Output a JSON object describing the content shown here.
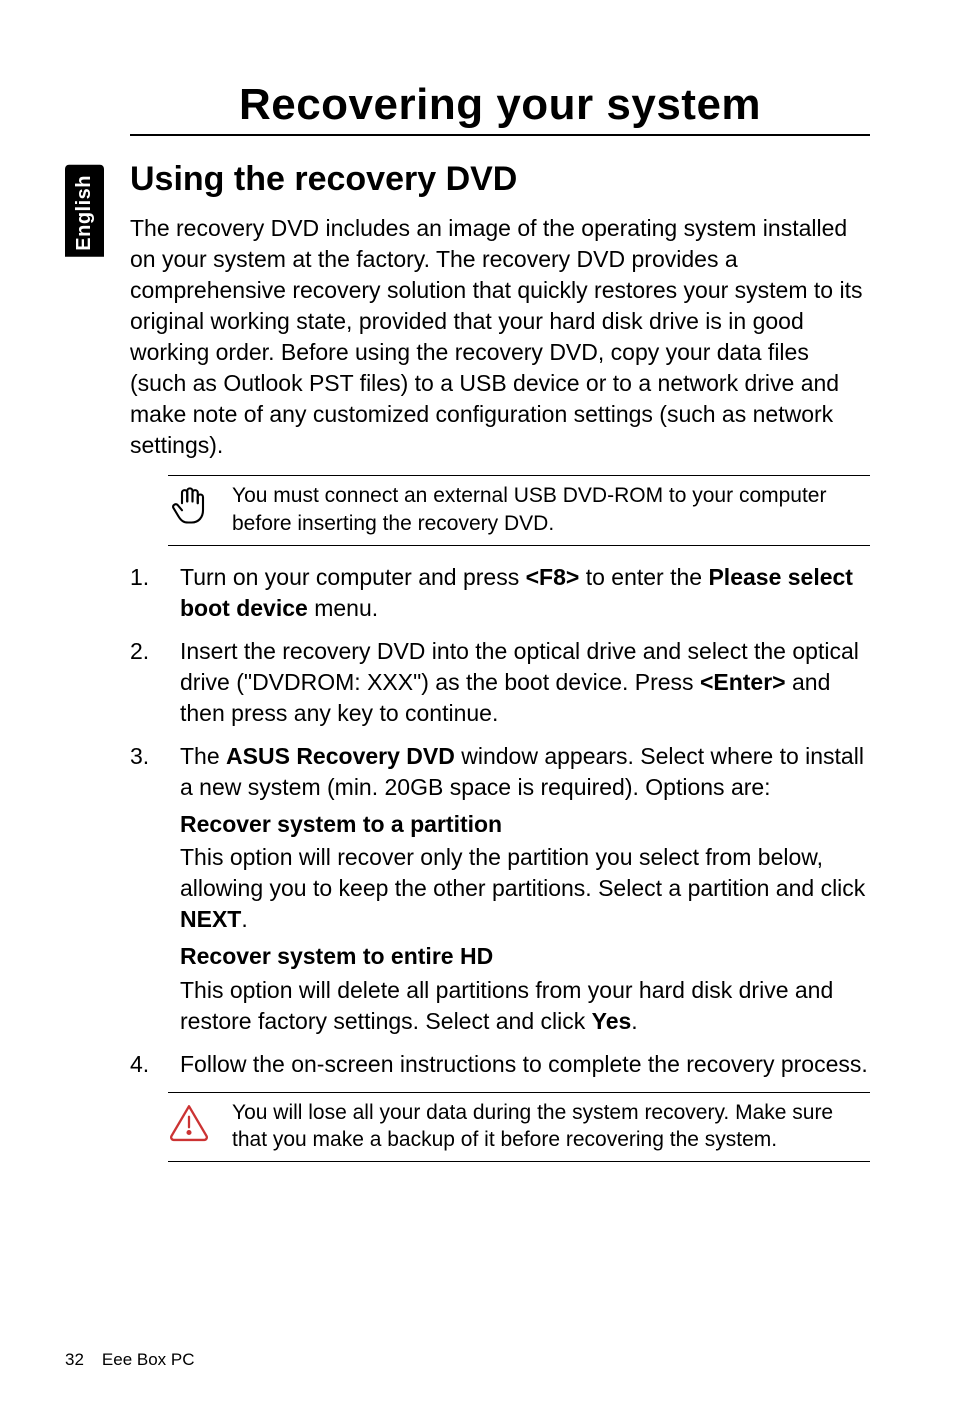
{
  "side_tab": "English",
  "title": "Recovering your system",
  "section": "Using the recovery DVD",
  "intro": "The recovery DVD includes an image of the operating system installed on your system at the factory. The recovery DVD provides a comprehensive recovery solution that quickly restores your system to its original working state, provided that your hard disk drive is in good working order. Before using the recovery DVD, copy your data files (such as Outlook PST files) to a USB device or to a network drive and make note of any customized configuration settings (such as network settings).",
  "note1": "You must connect an external USB DVD-ROM to your computer before inserting the recovery DVD.",
  "steps": {
    "s1a": "Turn on your computer and press ",
    "s1b": "<F8>",
    "s1c": " to enter the ",
    "s1d": "Please select boot device",
    "s1e": " menu.",
    "s2a": "Insert the recovery DVD into the optical drive and select the optical drive (\"DVDROM: XXX\") as the boot device. Press ",
    "s2b": "<Enter>",
    "s2c": " and then press any key to continue.",
    "s3a": "The ",
    "s3b": "ASUS Recovery DVD",
    "s3c": " window appears. Select where to install a new system (min. 20GB space is required). Options are:",
    "s3_opt1_head": "Recover system to a partition",
    "s3_opt1_body_a": "This option will recover only the partition you select from below, allowing you to keep the other partitions. Select a partition and click ",
    "s3_opt1_body_b": "NEXT",
    "s3_opt1_body_c": ".",
    "s3_opt2_head": "Recover system to entire HD",
    "s3_opt2_body_a": "This option will delete all partitions from your hard disk drive and restore factory settings. Select and click ",
    "s3_opt2_body_b": "Yes",
    "s3_opt2_body_c": ".",
    "s4": "Follow the on-screen instructions to complete the recovery process."
  },
  "warn": "You will lose all your data during the system recovery. Make sure that you make a backup of it before recovering the system.",
  "footer": {
    "page": "32",
    "label": "Eee Box PC"
  }
}
